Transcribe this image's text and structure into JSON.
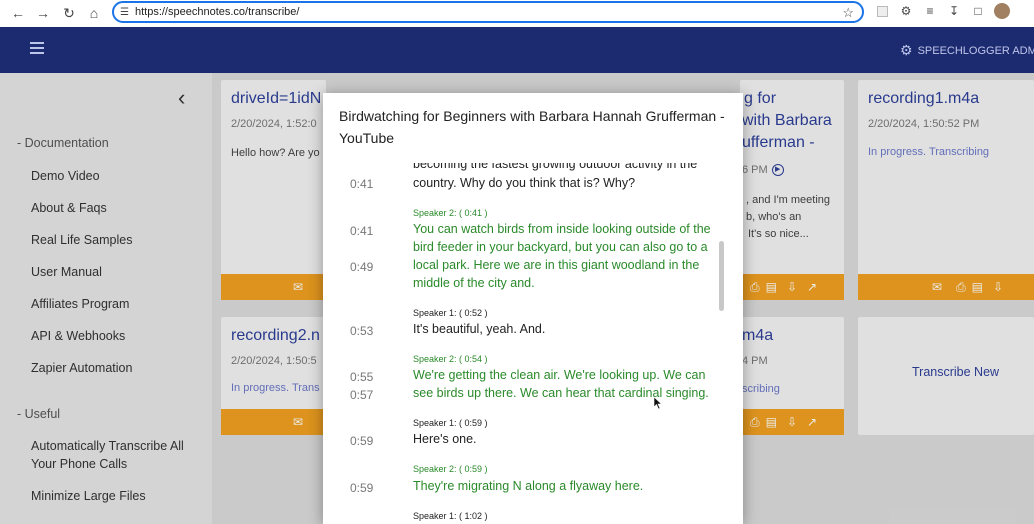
{
  "browser": {
    "url": "https://speechnotes.co/transcribe/"
  },
  "app": {
    "admin_label": "SPEECHLOGGER ADMI"
  },
  "sidebar": {
    "sections": [
      {
        "label": "- Documentation"
      },
      {
        "label": "- Useful"
      }
    ],
    "items": [
      {
        "label": "Demo Video"
      },
      {
        "label": "About & Faqs"
      },
      {
        "label": "Real Life Samples"
      },
      {
        "label": "User Manual"
      },
      {
        "label": "Affiliates Program"
      },
      {
        "label": "API & Webhooks"
      },
      {
        "label": "Zapier Automation"
      },
      {
        "label": "Automatically Transcribe All Your Phone Calls"
      },
      {
        "label": "Minimize Large Files"
      }
    ]
  },
  "cards": [
    {
      "title": "driveId=1idN",
      "date": "2/20/2024, 1:52:0",
      "text": "Hello how? Are yo"
    },
    {
      "title_lines": [
        "g for",
        "with Barbara",
        "ufferman -"
      ],
      "date": "6 PM",
      "text_lines": [
        ", and I'm meeting",
        "b, who's an",
        "It's so nice..."
      ]
    },
    {
      "title": "recording1.m4a",
      "date": "2/20/2024, 1:50:52 PM",
      "status": "In progress. Transcribing"
    },
    {
      "title": "recording2.n",
      "date": "2/20/2024, 1:50:5",
      "status": "In progress. Trans"
    },
    {
      "title": "m4a",
      "date": "4 PM",
      "status": "scribing"
    },
    {
      "action": "Transcribe New"
    }
  ],
  "modal": {
    "title": "Birdwatching for Beginners with Barbara Hannah Grufferman - YouTube",
    "partial_line": "becoming the fastest growing outdoor activity in the",
    "segments": [
      {
        "speaker": "",
        "lines": [
          {
            "time": "0:41",
            "text": "country. Why do you think that is? Why?"
          }
        ],
        "voice": "s1"
      },
      {
        "speaker": "Speaker 2: ( 0:41 )",
        "lines": [
          {
            "time": "0:41",
            "text": "You can watch birds from inside looking outside of the"
          },
          {
            "time": "",
            "text": "bird feeder in your backyard, but you can also go to a"
          },
          {
            "time": "0:49",
            "text": "local park. Here we are in this giant woodland in the"
          },
          {
            "time": "",
            "text": "middle of the city and."
          }
        ],
        "voice": "s2"
      },
      {
        "speaker": "Speaker 1: ( 0:52 )",
        "lines": [
          {
            "time": "0:53",
            "text": "It's beautiful, yeah. And."
          }
        ],
        "voice": "s1"
      },
      {
        "speaker": "Speaker 2: ( 0:54 )",
        "lines": [
          {
            "time": "0:55",
            "text": "We're getting the clean air. We're looking up. We can"
          },
          {
            "time": "0:57",
            "text": "see birds up there. We can hear that cardinal singing."
          }
        ],
        "voice": "s2"
      },
      {
        "speaker": "Speaker 1: ( 0:59 )",
        "lines": [
          {
            "time": "0:59",
            "text": "Here's one."
          }
        ],
        "voice": "s1"
      },
      {
        "speaker": "Speaker 2: ( 0:59 )",
        "lines": [
          {
            "time": "0:59",
            "text": "They're migrating N along a flyaway here."
          }
        ],
        "voice": "s2"
      },
      {
        "speaker": "Speaker 1: ( 1:02 )",
        "lines": [],
        "voice": "s1"
      }
    ]
  },
  "colors": {
    "topbar": "#1f2f7a",
    "accent_footer": "#f0a020",
    "speaker2_text": "#2a8a2a",
    "title_blue": "#2d3f9a"
  }
}
